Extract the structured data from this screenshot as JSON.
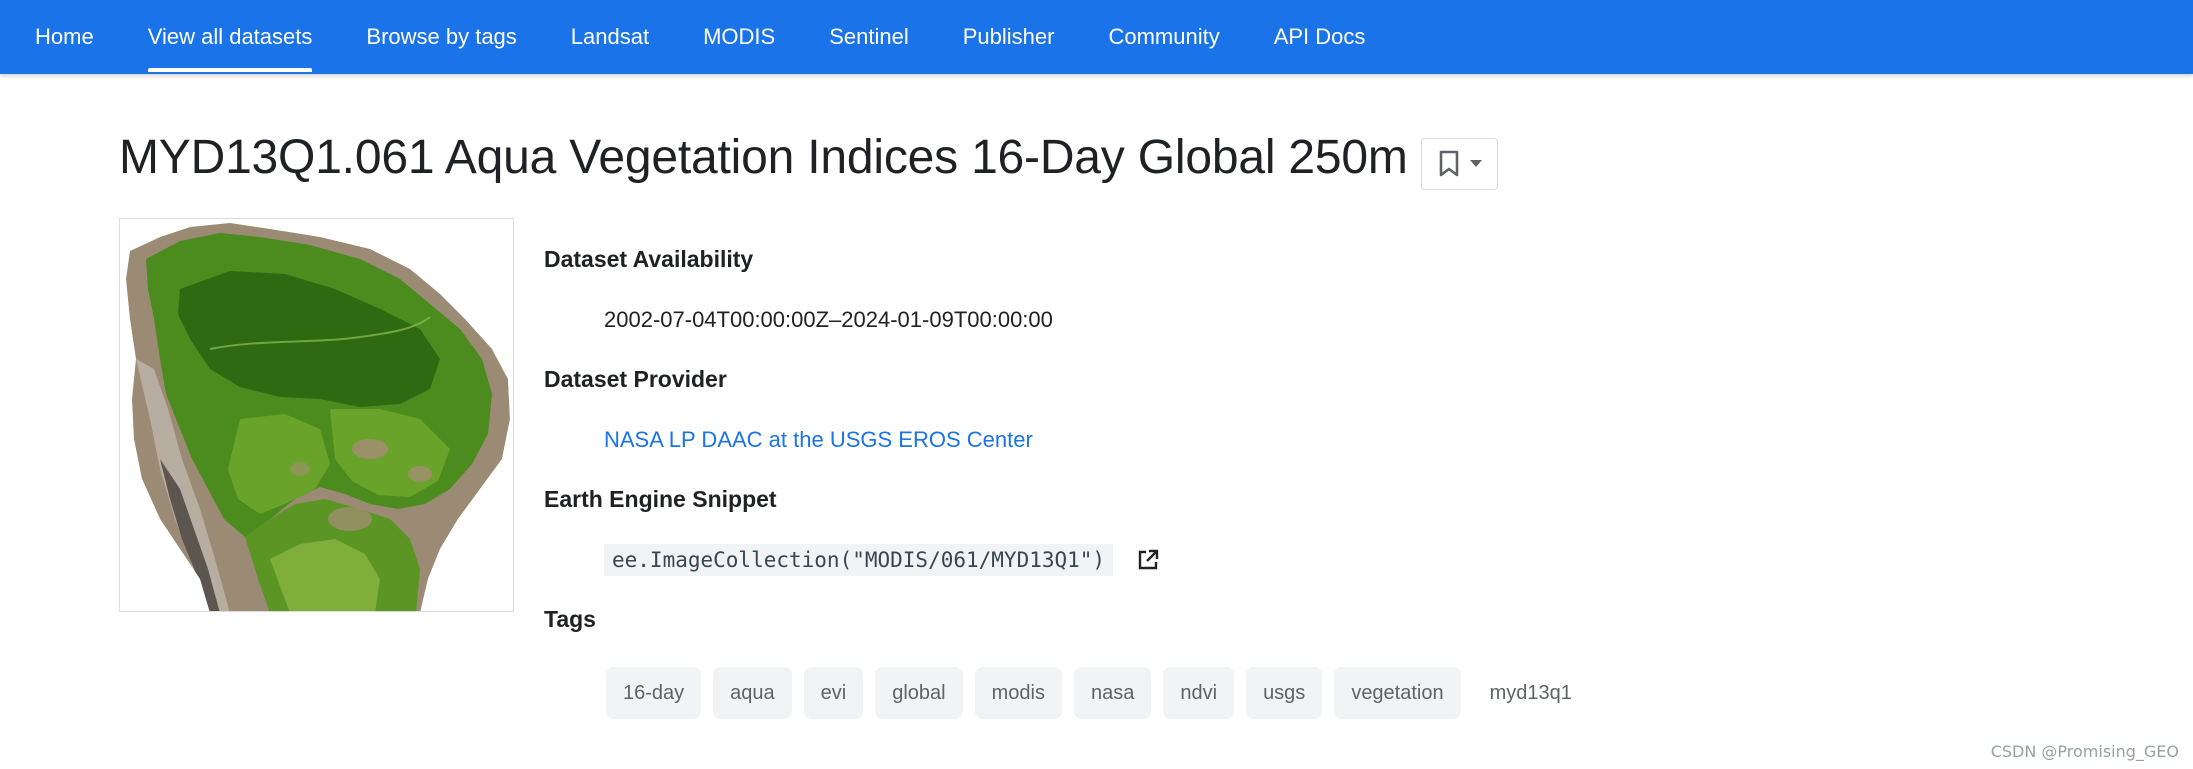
{
  "nav": {
    "items": [
      {
        "label": "Home",
        "active": false
      },
      {
        "label": "View all datasets",
        "active": true
      },
      {
        "label": "Browse by tags",
        "active": false
      },
      {
        "label": "Landsat",
        "active": false
      },
      {
        "label": "MODIS",
        "active": false
      },
      {
        "label": "Sentinel",
        "active": false
      },
      {
        "label": "Publisher",
        "active": false
      },
      {
        "label": "Community",
        "active": false
      },
      {
        "label": "API Docs",
        "active": false
      }
    ],
    "accent_color": "#1a73e8"
  },
  "page": {
    "title": "MYD13Q1.061 Aqua Vegetation Indices 16-Day Global 250m",
    "bookmark_icon": "bookmark-icon"
  },
  "details": {
    "availability_label": "Dataset Availability",
    "availability_value": "2002-07-04T00:00:00Z–2024-01-09T00:00:00",
    "provider_label": "Dataset Provider",
    "provider_value": "NASA LP DAAC at the USGS EROS Center",
    "snippet_label": "Earth Engine Snippet",
    "snippet_value": "ee.ImageCollection(\"MODIS/061/MYD13Q1\")",
    "snippet_icon": "open-in-new-icon",
    "tags_label": "Tags"
  },
  "tags": [
    "16-day",
    "aqua",
    "evi",
    "global",
    "modis",
    "nasa",
    "ndvi",
    "usgs",
    "vegetation",
    "myd13q1"
  ],
  "watermark": "CSDN @Promising_GEO"
}
